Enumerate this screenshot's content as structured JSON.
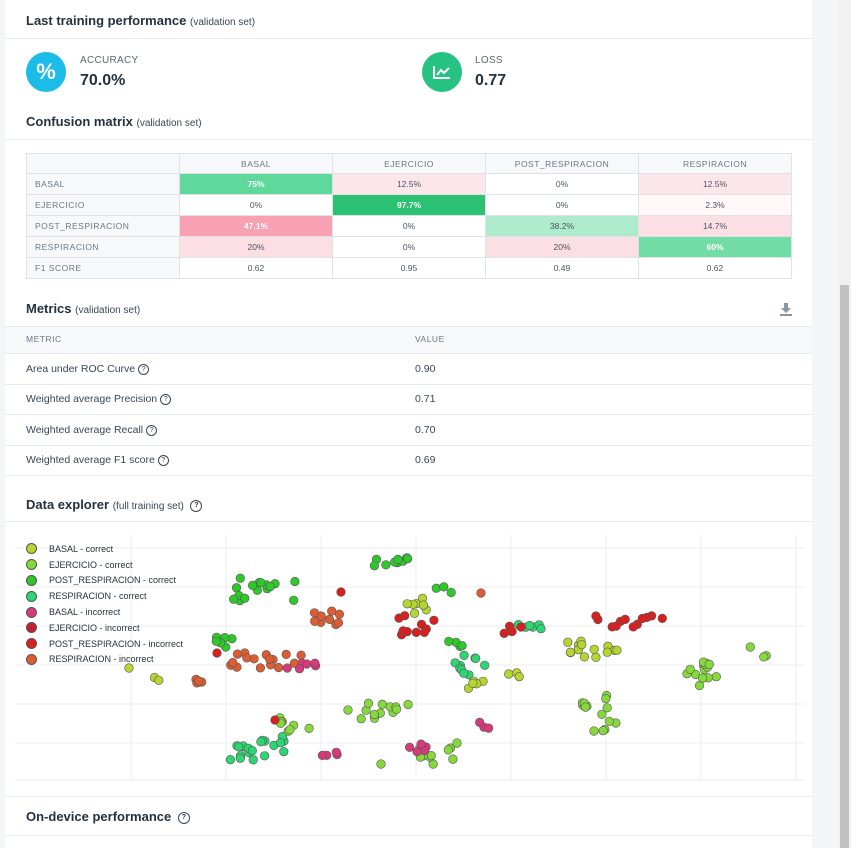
{
  "last_training": {
    "title": "Last training performance",
    "subtitle": "(validation set)",
    "accuracy_label": "ACCURACY",
    "accuracy_value": "70.0%",
    "loss_label": "LOSS",
    "loss_value": "0.77",
    "accuracy_icon_symbol": "%",
    "accuracy_icon": "percent-icon",
    "loss_icon": "chart-line-icon",
    "accuracy_color": "#1bbde8",
    "loss_color": "#26c282"
  },
  "confusion": {
    "title": "Confusion matrix",
    "subtitle": "(validation set)",
    "columns": [
      "BASAL",
      "EJERCICIO",
      "POST_RESPIRACION",
      "RESPIRACION"
    ],
    "rows": [
      {
        "label": "BASAL",
        "cells": [
          "75%",
          "12.5%",
          "0%",
          "12.5%"
        ]
      },
      {
        "label": "EJERCICIO",
        "cells": [
          "0%",
          "97.7%",
          "0%",
          "2.3%"
        ]
      },
      {
        "label": "POST_RESPIRACION",
        "cells": [
          "47.1%",
          "0%",
          "38.2%",
          "14.7%"
        ]
      },
      {
        "label": "RESPIRACION",
        "cells": [
          "20%",
          "0%",
          "20%",
          "60%"
        ]
      }
    ],
    "f1_label": "F1 SCORE",
    "f1": [
      "0.62",
      "0.95",
      "0.49",
      "0.62"
    ]
  },
  "metrics": {
    "title": "Metrics",
    "subtitle": "(validation set)",
    "download_icon": "download-icon",
    "col_metric": "METRIC",
    "col_value": "VALUE",
    "rows": [
      {
        "label": "Area under ROC Curve",
        "value": "0.90"
      },
      {
        "label": "Weighted average Precision",
        "value": "0.71"
      },
      {
        "label": "Weighted average Recall",
        "value": "0.70"
      },
      {
        "label": "Weighted average F1 score",
        "value": "0.69"
      }
    ]
  },
  "explorer": {
    "title": "Data explorer",
    "subtitle": "(full training set)",
    "legend": [
      {
        "label": "BASAL - correct",
        "color": "#b5d531"
      },
      {
        "label": "EJERCICIO - correct",
        "color": "#86d93c"
      },
      {
        "label": "POST_RESPIRACION - correct",
        "color": "#2ec82b"
      },
      {
        "label": "RESPIRACION - correct",
        "color": "#2dd672"
      },
      {
        "label": "BASAL - incorrect",
        "color": "#d63a7a"
      },
      {
        "label": "EJERCICIO - incorrect",
        "color": "#c51f31"
      },
      {
        "label": "POST_RESPIRACION - incorrect",
        "color": "#d8201e"
      },
      {
        "label": "RESPIRACION - incorrect",
        "color": "#dd5d33"
      }
    ]
  },
  "on_device": {
    "title": "On-device performance"
  }
}
